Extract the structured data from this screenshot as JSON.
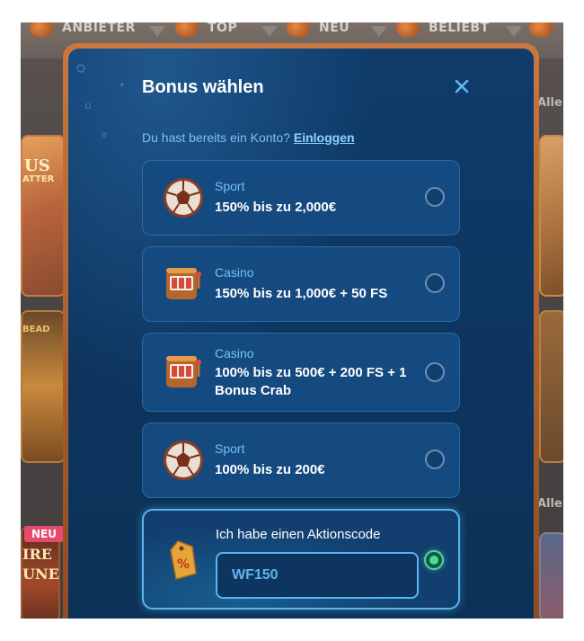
{
  "background": {
    "categories": [
      "ANBIETER",
      "TOP",
      "NEU",
      "BELIEBT"
    ],
    "neu_badge": "NEU",
    "alle_label": "Alle",
    "left_tile_texts": [
      "US",
      "ATTER",
      "BEAD",
      "IRE",
      "UNE"
    ]
  },
  "modal": {
    "title": "Bonus wählen",
    "close_icon": "close-icon",
    "login_prompt": "Du hast bereits ein Konto?",
    "login_link": "Einloggen",
    "bonuses": [
      {
        "category": "Sport",
        "offer": "150% bis zu 2,000€",
        "icon": "soccer-ball-icon",
        "selected": false
      },
      {
        "category": "Casino",
        "offer": "150% bis zu 1,000€ + 50 FS",
        "icon": "slot-machine-icon",
        "selected": false
      },
      {
        "category": "Casino",
        "offer": "100% bis zu 500€ + 200 FS + 1 Bonus Crab",
        "icon": "slot-machine-icon",
        "selected": false
      },
      {
        "category": "Sport",
        "offer": "100% bis zu 200€",
        "icon": "soccer-ball-icon",
        "selected": false
      }
    ],
    "promo": {
      "label": "Ich habe einen Aktionscode",
      "code": "WF150",
      "icon": "discount-tag-icon",
      "selected": true
    }
  },
  "colors": {
    "modal_bg": "#0f3c6b",
    "card_bg": "#154a80",
    "accent_blue": "#56b6f0",
    "selected_green": "#4fdc91",
    "frame_orange": "#c9773e"
  }
}
